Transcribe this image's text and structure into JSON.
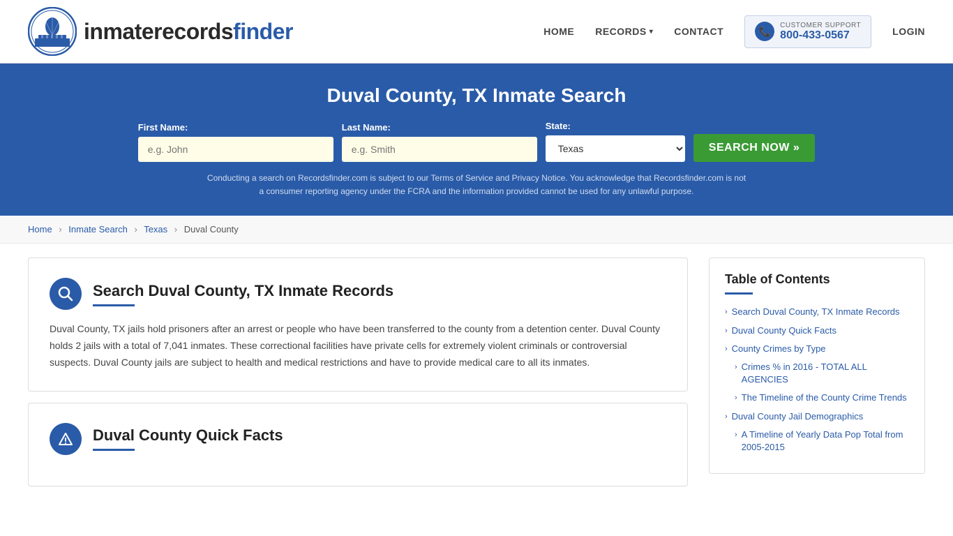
{
  "site": {
    "logo_text_normal": "inmaterecords",
    "logo_text_bold": "finder",
    "tagline": "inmaterecordsfinder"
  },
  "nav": {
    "home_label": "HOME",
    "records_label": "RECORDS",
    "contact_label": "CONTACT",
    "support_label": "CUSTOMER SUPPORT",
    "support_number": "800-433-0567",
    "login_label": "LOGIN"
  },
  "search_banner": {
    "heading": "Duval County, TX Inmate Search",
    "first_name_label": "First Name:",
    "first_name_placeholder": "e.g. John",
    "last_name_label": "Last Name:",
    "last_name_placeholder": "e.g. Smith",
    "state_label": "State:",
    "state_value": "Texas",
    "search_button_label": "SEARCH NOW »",
    "disclaimer": "Conducting a search on Recordsfinder.com is subject to our Terms of Service and Privacy Notice. You acknowledge that Recordsfinder.com is not a consumer reporting agency under the FCRA and the information provided cannot be used for any unlawful purpose."
  },
  "breadcrumb": {
    "home": "Home",
    "inmate_search": "Inmate Search",
    "state": "Texas",
    "county": "Duval County"
  },
  "main_section": {
    "title": "Search Duval County, TX Inmate Records",
    "body": "Duval County, TX jails hold prisoners after an arrest or people who have been transferred to the county from a detention center. Duval County holds 2 jails with a total of 7,041 inmates. These correctional facilities have private cells for extremely violent criminals or controversial suspects. Duval County jails are subject to health and medical restrictions and have to provide medical care to all its inmates."
  },
  "quick_facts_section": {
    "title": "Duval County Quick Facts"
  },
  "toc": {
    "title": "Table of Contents",
    "items": [
      {
        "label": "Search Duval County, TX Inmate Records",
        "sub": false
      },
      {
        "label": "Duval County Quick Facts",
        "sub": false
      },
      {
        "label": "County Crimes by Type",
        "sub": false
      },
      {
        "label": "Crimes % in 2016 - TOTAL ALL AGENCIES",
        "sub": true
      },
      {
        "label": "The Timeline of the County Crime Trends",
        "sub": true
      },
      {
        "label": "Duval County Jail Demographics",
        "sub": false
      },
      {
        "label": "A Timeline of Yearly Data Pop Total from 2005-2015",
        "sub": true
      }
    ]
  }
}
